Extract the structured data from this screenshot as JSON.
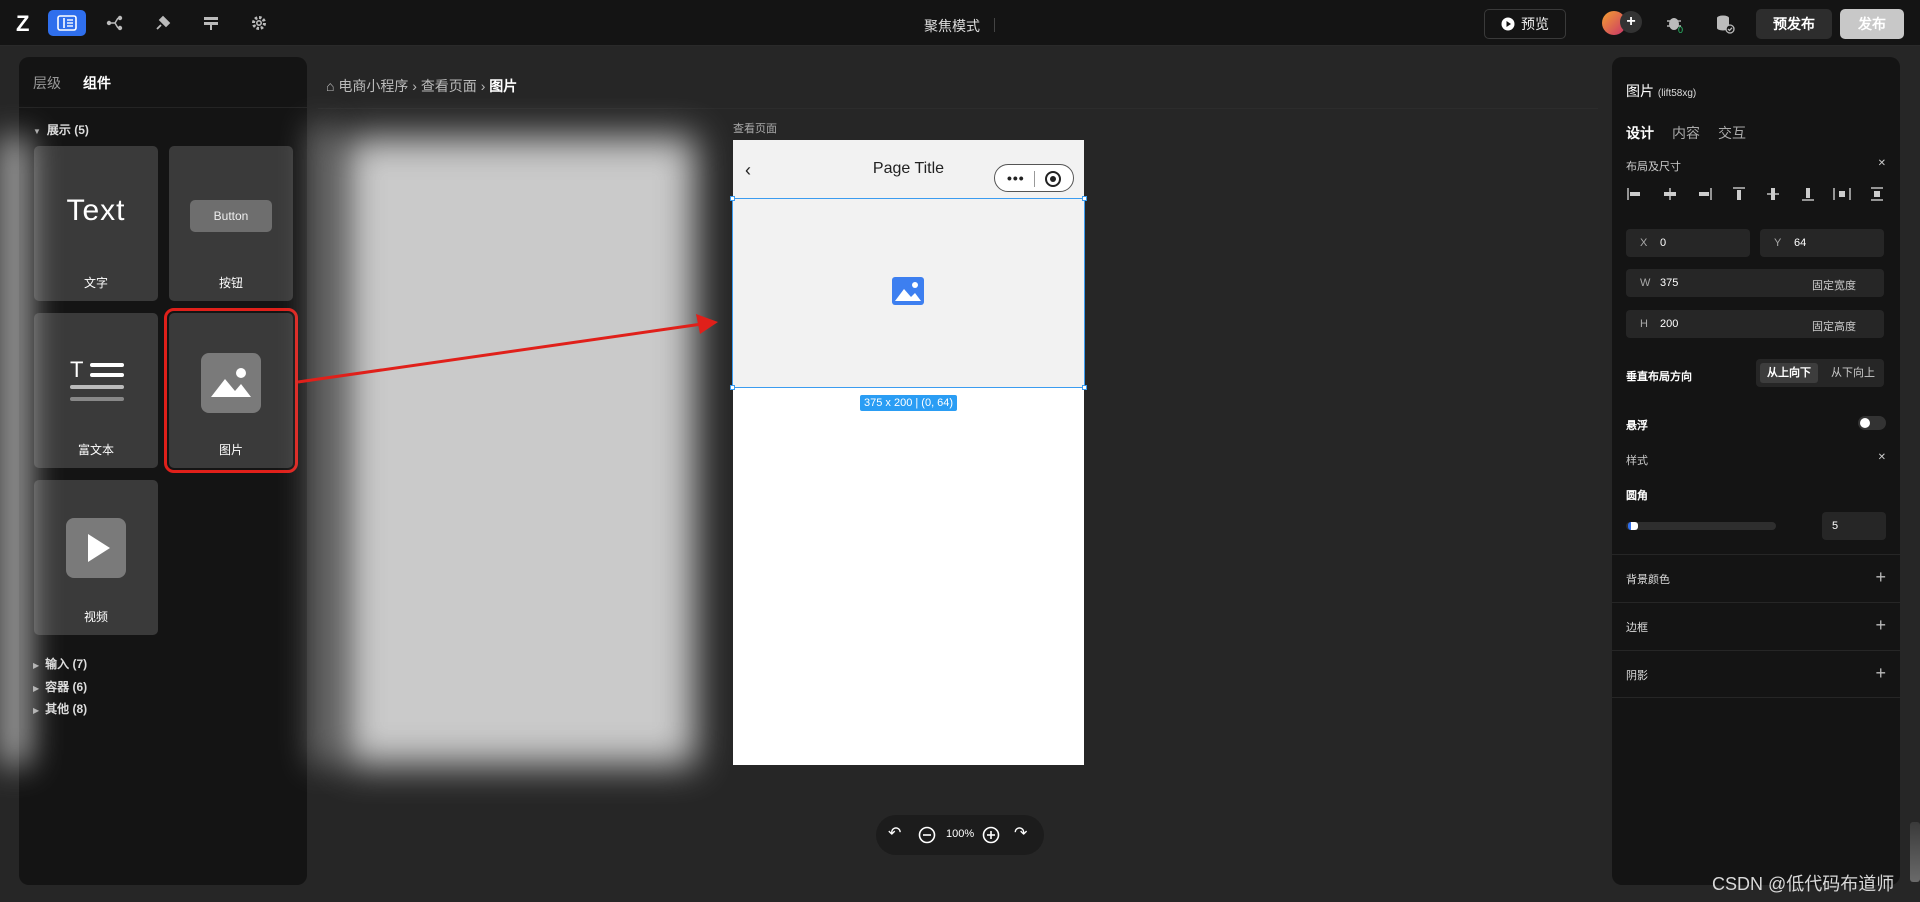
{
  "topbar": {
    "logo": "Z",
    "focus_mode": "聚焦模式",
    "preview_label": "预览",
    "prepublish_label": "预发布",
    "publish_label": "发布",
    "icons": [
      "pages-icon",
      "flow-icon",
      "plugin-icon",
      "data-icon",
      "settings-icon"
    ],
    "accent_color": "#2f6fed"
  },
  "left_panel": {
    "tabs": [
      "层级",
      "组件"
    ],
    "active_tab": "组件",
    "groups": [
      {
        "label": "展示 (5)",
        "expanded": true
      },
      {
        "label": "输入 (7)",
        "expanded": false
      },
      {
        "label": "容器 (6)",
        "expanded": false
      },
      {
        "label": "其他 (8)",
        "expanded": false
      }
    ],
    "components": [
      {
        "label": "文字",
        "glyph": "Text"
      },
      {
        "label": "按钮",
        "glyph": "Button"
      },
      {
        "label": "富文本",
        "glyph": "T"
      },
      {
        "label": "图片",
        "glyph": "image",
        "selected": true
      },
      {
        "label": "视频",
        "glyph": "play"
      }
    ]
  },
  "breadcrumb": {
    "icon": "⌂",
    "items": [
      "电商小程序",
      "查看页面",
      "图片"
    ]
  },
  "canvas": {
    "page_label": "查看页面",
    "nav_title": "Page Title",
    "size_tag": "375 x 200 | (0, 64)",
    "zoom": "100%",
    "highlight_color": "#3b9cf0",
    "arrow_color": "#e0201a"
  },
  "right_panel": {
    "title": "图片",
    "title_id": "(lift58xg)",
    "tabs": [
      "设计",
      "内容",
      "交互"
    ],
    "active_tab": "设计",
    "layout_section": "布局及尺寸",
    "x_label": "X",
    "x_value": "0",
    "y_label": "Y",
    "y_value": "64",
    "w_label": "W",
    "w_value": "375",
    "w_mode": "固定宽度",
    "h_label": "H",
    "h_value": "200",
    "h_mode": "固定高度",
    "direction_label": "垂直布局方向",
    "direction_on": "从上向下",
    "direction_off": "从下向上",
    "float_label": "悬浮",
    "float_enabled": false,
    "style_section": "样式",
    "radius_label": "圆角",
    "radius_value": "5",
    "radius_fraction": 0.05,
    "bg_label": "背景颜色",
    "border_label": "边框",
    "shadow_label": "阴影"
  },
  "watermark": "CSDN @低代码布道师"
}
